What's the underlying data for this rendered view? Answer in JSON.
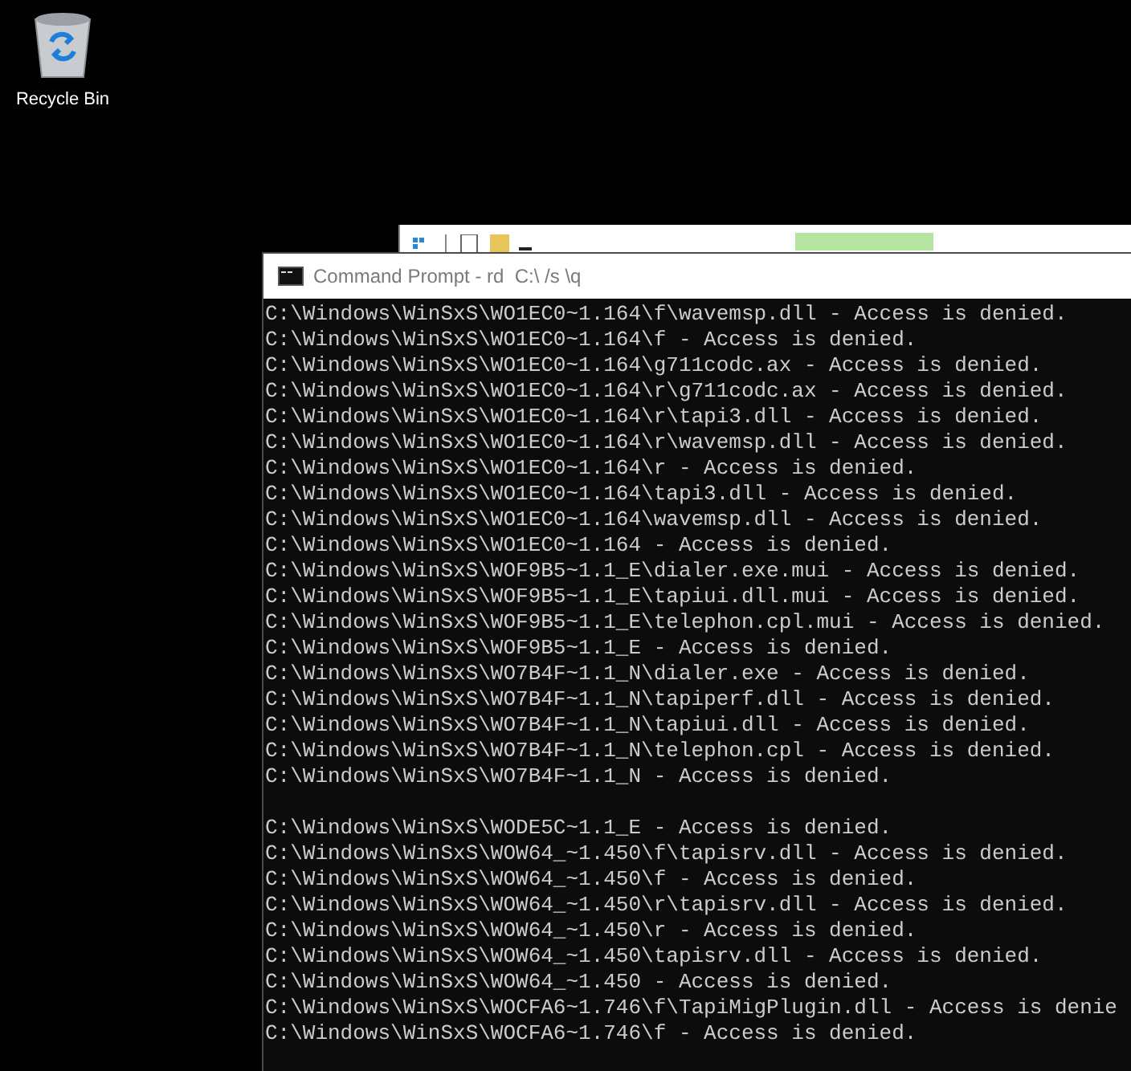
{
  "desktop_icons": [
    {
      "label": "Recycle Bin"
    }
  ],
  "console": {
    "title": "Command Prompt - rd  C:\\ /s \\q",
    "blocks": [
      [
        "C:\\Windows\\WinSxS\\WO1EC0~1.164\\f\\wavemsp.dll - Access is denied.",
        "C:\\Windows\\WinSxS\\WO1EC0~1.164\\f - Access is denied.",
        "C:\\Windows\\WinSxS\\WO1EC0~1.164\\g711codc.ax - Access is denied.",
        "C:\\Windows\\WinSxS\\WO1EC0~1.164\\r\\g711codc.ax - Access is denied.",
        "C:\\Windows\\WinSxS\\WO1EC0~1.164\\r\\tapi3.dll - Access is denied.",
        "C:\\Windows\\WinSxS\\WO1EC0~1.164\\r\\wavemsp.dll - Access is denied.",
        "C:\\Windows\\WinSxS\\WO1EC0~1.164\\r - Access is denied.",
        "C:\\Windows\\WinSxS\\WO1EC0~1.164\\tapi3.dll - Access is denied.",
        "C:\\Windows\\WinSxS\\WO1EC0~1.164\\wavemsp.dll - Access is denied.",
        "C:\\Windows\\WinSxS\\WO1EC0~1.164 - Access is denied.",
        "C:\\Windows\\WinSxS\\WOF9B5~1.1_E\\dialer.exe.mui - Access is denied.",
        "C:\\Windows\\WinSxS\\WOF9B5~1.1_E\\tapiui.dll.mui - Access is denied.",
        "C:\\Windows\\WinSxS\\WOF9B5~1.1_E\\telephon.cpl.mui - Access is denied.",
        "C:\\Windows\\WinSxS\\WOF9B5~1.1_E - Access is denied.",
        "C:\\Windows\\WinSxS\\WO7B4F~1.1_N\\dialer.exe - Access is denied.",
        "C:\\Windows\\WinSxS\\WO7B4F~1.1_N\\tapiperf.dll - Access is denied.",
        "C:\\Windows\\WinSxS\\WO7B4F~1.1_N\\tapiui.dll - Access is denied.",
        "C:\\Windows\\WinSxS\\WO7B4F~1.1_N\\telephon.cpl - Access is denied.",
        "C:\\Windows\\WinSxS\\WO7B4F~1.1_N - Access is denied."
      ],
      [
        "C:\\Windows\\WinSxS\\WODE5C~1.1_E - Access is denied.",
        "C:\\Windows\\WinSxS\\WOW64_~1.450\\f\\tapisrv.dll - Access is denied.",
        "C:\\Windows\\WinSxS\\WOW64_~1.450\\f - Access is denied.",
        "C:\\Windows\\WinSxS\\WOW64_~1.450\\r\\tapisrv.dll - Access is denied.",
        "C:\\Windows\\WinSxS\\WOW64_~1.450\\r - Access is denied.",
        "C:\\Windows\\WinSxS\\WOW64_~1.450\\tapisrv.dll - Access is denied.",
        "C:\\Windows\\WinSxS\\WOW64_~1.450 - Access is denied.",
        "C:\\Windows\\WinSxS\\WOCFA6~1.746\\f\\TapiMigPlugin.dll - Access is denie",
        "C:\\Windows\\WinSxS\\WOCFA6~1.746\\f - Access is denied."
      ]
    ]
  }
}
